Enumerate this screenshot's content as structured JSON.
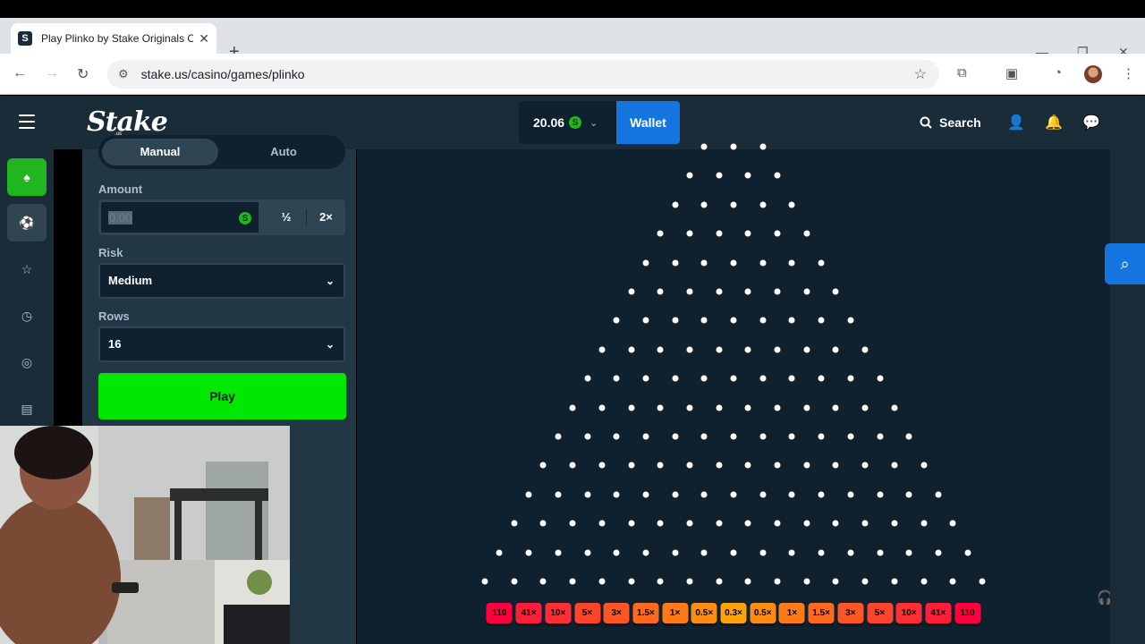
{
  "browser": {
    "tab_title": "Play Plinko by Stake Originals C",
    "tab_favicon": "S",
    "url": "stake.us/casino/games/plinko"
  },
  "header": {
    "logo": "Stake",
    "logo_sub": ".us",
    "balance": "20.06",
    "currency_symbol": "S",
    "wallet_label": "Wallet",
    "search_label": "Search"
  },
  "controls": {
    "tabs": [
      "Manual",
      "Auto"
    ],
    "amount_label": "Amount",
    "amount_value": "0.00",
    "half_label": "½",
    "double_label": "2×",
    "risk_label": "Risk",
    "risk_value": "Medium",
    "rows_label": "Rows",
    "rows_value": "16",
    "play_label": "Play"
  },
  "board": {
    "rows": 16,
    "multipliers": [
      "110",
      "41×",
      "10×",
      "5×",
      "3×",
      "1.5×",
      "1×",
      "0.5×",
      "0.3×",
      "0.5×",
      "1×",
      "1.5×",
      "3×",
      "5×",
      "10×",
      "41×",
      "110"
    ],
    "bucket_colors": [
      "#ff003f",
      "#ff1d3a",
      "#fe2f34",
      "#fe442b",
      "#fd5526",
      "#fd6a1f",
      "#fc7b18",
      "#fc8d12",
      "#fca30b",
      "#fc8d12",
      "#fc7b18",
      "#fd6a1f",
      "#fd5526",
      "#fe442b",
      "#fe2f34",
      "#ff1d3a",
      "#ff003f"
    ]
  },
  "colors": {
    "header_bg": "#1a2c38",
    "panel_bg": "#213743",
    "board_bg": "#0f212e",
    "play_green": "#00e701",
    "wallet_blue": "#1475e1"
  }
}
